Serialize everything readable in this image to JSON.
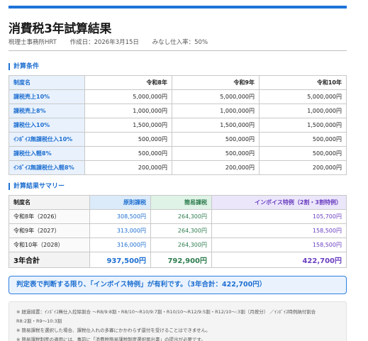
{
  "header": {
    "title": "消費税3年試算結果",
    "office": "税理士事務所HRT",
    "created": "作成日：2026年3月15日",
    "deemed": "みなし仕入率：50%"
  },
  "conditions": {
    "section_title": "計算条件",
    "col_label": "制度名",
    "years": [
      "令和8年",
      "令和9年",
      "令和10年"
    ],
    "rows": [
      {
        "label": "課税売上10%",
        "values": [
          "5,000,000円",
          "5,000,000円",
          "5,000,000円"
        ]
      },
      {
        "label": "課税売上8%",
        "values": [
          "1,000,000円",
          "1,000,000円",
          "1,000,000円"
        ]
      },
      {
        "label": "課税仕入10%",
        "values": [
          "1,500,000円",
          "1,500,000円",
          "1,500,000円"
        ]
      },
      {
        "label": "ｲﾝﾎﾞｲｽ無課税仕入10%",
        "values": [
          "500,000円",
          "500,000円",
          "500,000円"
        ]
      },
      {
        "label": "課税仕入軽8%",
        "values": [
          "500,000円",
          "500,000円",
          "500,000円"
        ]
      },
      {
        "label": "ｲﾝﾎﾞｲｽ無課税仕入軽8%",
        "values": [
          "200,000円",
          "200,000円",
          "200,000円"
        ]
      }
    ]
  },
  "summary": {
    "section_title": "計算結果サマリー",
    "headers": [
      "制度名",
      "原則課税",
      "簡易課税",
      "インボイス特例（2割・3割特例）"
    ],
    "rows": [
      {
        "label": "令和8年（2026）",
        "values": [
          "308,500円",
          "264,300円",
          "105,700円"
        ]
      },
      {
        "label": "令和9年（2027）",
        "values": [
          "313,000円",
          "264,300円",
          "158,500円"
        ]
      },
      {
        "label": "令和10年（2028）",
        "values": [
          "316,000円",
          "264,300円",
          "158,500円"
        ]
      }
    ],
    "total": {
      "label": "3年合計",
      "values": [
        "937,500円",
        "792,900円",
        "422,700円"
      ]
    }
  },
  "verdict": "判定表で判断する限り、「インボイス特例」が有利です。（3年合計：422,700円）",
  "notes": [
    "※ 経過措置：ｲﾝﾎﾞｲｽ無仕入控除割合 〜R8/9:8割・R8/10〜R10/9:7割・R10/10〜R12/9:5割・R12/10〜:3割（月按分） ／ｲﾝﾎﾞｲｽ特例納付割合",
    "R8:2割・R9〜10:3割",
    "※ 簡易課税を選択した場合、課税仕入れの多寡にかかわらず還付を受けることはできません。",
    "※ 簡易課税制度の適用には、事前に「消費税簡易課税制度選択届出書」の提出が必要です。"
  ],
  "colors": {
    "accent": "#1e73d8",
    "principle": "#1e6fd1",
    "simplified": "#2e7d4f",
    "invoice": "#6a3fc1"
  }
}
